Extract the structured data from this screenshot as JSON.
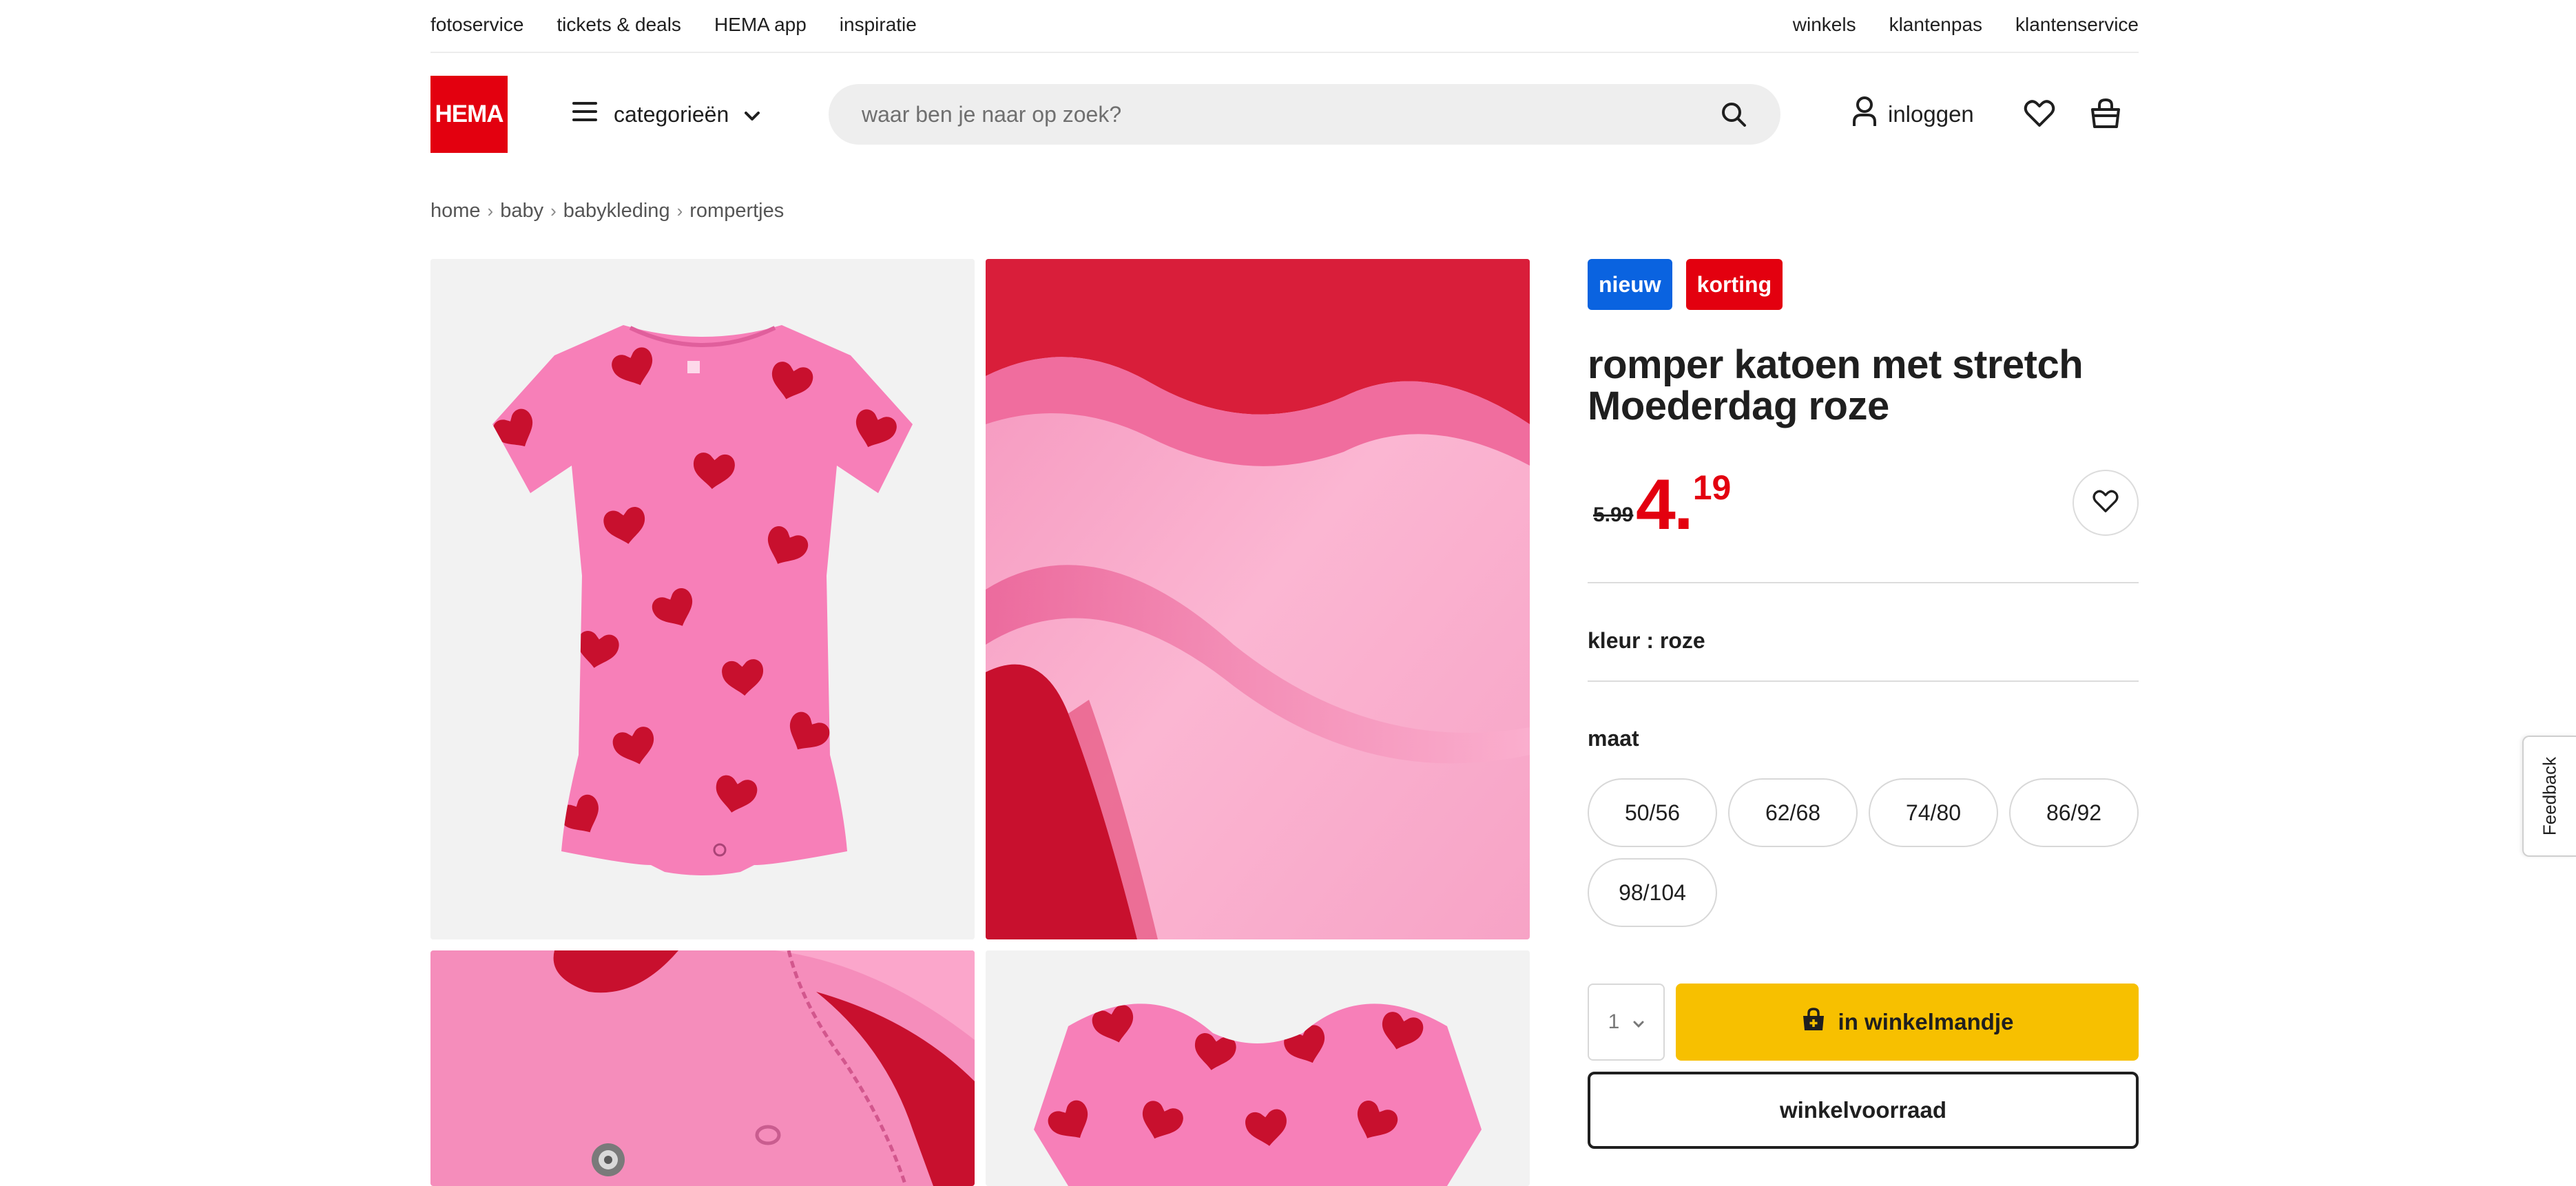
{
  "top_bar": {
    "left_links": [
      "fotoservice",
      "tickets & deals",
      "HEMA app",
      "inspiratie"
    ],
    "right_links": [
      "winkels",
      "klantenpas",
      "klantenservice"
    ]
  },
  "header": {
    "logo_text": "HEMA",
    "categories_label": "categorieën",
    "search_placeholder": "waar ben je naar op zoek?",
    "login_label": "inloggen",
    "icons": [
      "menu-icon",
      "chevron-down-icon",
      "search-icon",
      "user-icon",
      "heart-icon",
      "basket-icon"
    ]
  },
  "breadcrumb": [
    "home",
    "baby",
    "babykleding",
    "rompertjes"
  ],
  "product": {
    "badges": {
      "new": "nieuw",
      "sale": "korting"
    },
    "title": "romper katoen met stretch Moederdag roze",
    "price_old": "5.99",
    "price_new_int": "4.",
    "price_new_dec": "19",
    "color_text": "kleur : roze",
    "size_label": "maat",
    "sizes": [
      "50/56",
      "62/68",
      "74/80",
      "86/92",
      "98/104"
    ],
    "quantity": "1",
    "add_to_cart": "in winkelmandje",
    "store_stock": "winkelvoorraad"
  },
  "feedback_label": "Feedback",
  "colors": {
    "brand_red": "#e3000f",
    "new_badge_blue": "#0a63e0",
    "cta_yellow": "#f7c000",
    "romper_pink": "#f77fb8",
    "heart_red": "#c8102e"
  }
}
